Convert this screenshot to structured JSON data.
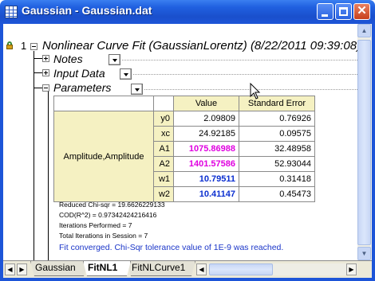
{
  "window": {
    "title": "Gaussian - Gaussian.dat",
    "icon": "worksheet-grid-icon",
    "accent_color": "#1d55d8"
  },
  "report": {
    "node_number": "1",
    "title": "Nonlinear Curve Fit (GaussianLorentz) (8/22/2011 09:39:08)",
    "sections": {
      "notes": "Notes",
      "input_data": "Input Data",
      "parameters": "Parameters"
    }
  },
  "parameters_table": {
    "headers": {
      "value": "Value",
      "std_error": "Standard Error"
    },
    "group_label": "Amplitude,Amplitude",
    "rows": [
      {
        "name": "y0",
        "value": "2.09809",
        "error": "0.76926"
      },
      {
        "name": "xc",
        "value": "24.92185",
        "error": "0.09575"
      },
      {
        "name": "A1",
        "value": "1075.86988",
        "error": "32.48958"
      },
      {
        "name": "A2",
        "value": "1401.57586",
        "error": "52.93044"
      },
      {
        "name": "w1",
        "value": "10.79511",
        "error": "0.31418"
      },
      {
        "name": "w2",
        "value": "10.41147",
        "error": "0.45473"
      }
    ],
    "highlight_colors": {
      "amplitude": "#e000e0",
      "width": "#0b2fd0"
    }
  },
  "statistics": {
    "reduced_chi_sqr": "Reduced Chi-sqr = 19.6626229133",
    "cod": "COD(R^2) = 0.97342424216416",
    "iterations": "Iterations Performed = 7",
    "total_iterations": "Total Iterations in Session = 7",
    "converged": "Fit converged. Chi-Sqr tolerance value of 1E-9 was reached."
  },
  "tabs": {
    "items": [
      "Gaussian",
      "FitNL1",
      "FitNLCurve1"
    ],
    "active": "FitNL1"
  }
}
